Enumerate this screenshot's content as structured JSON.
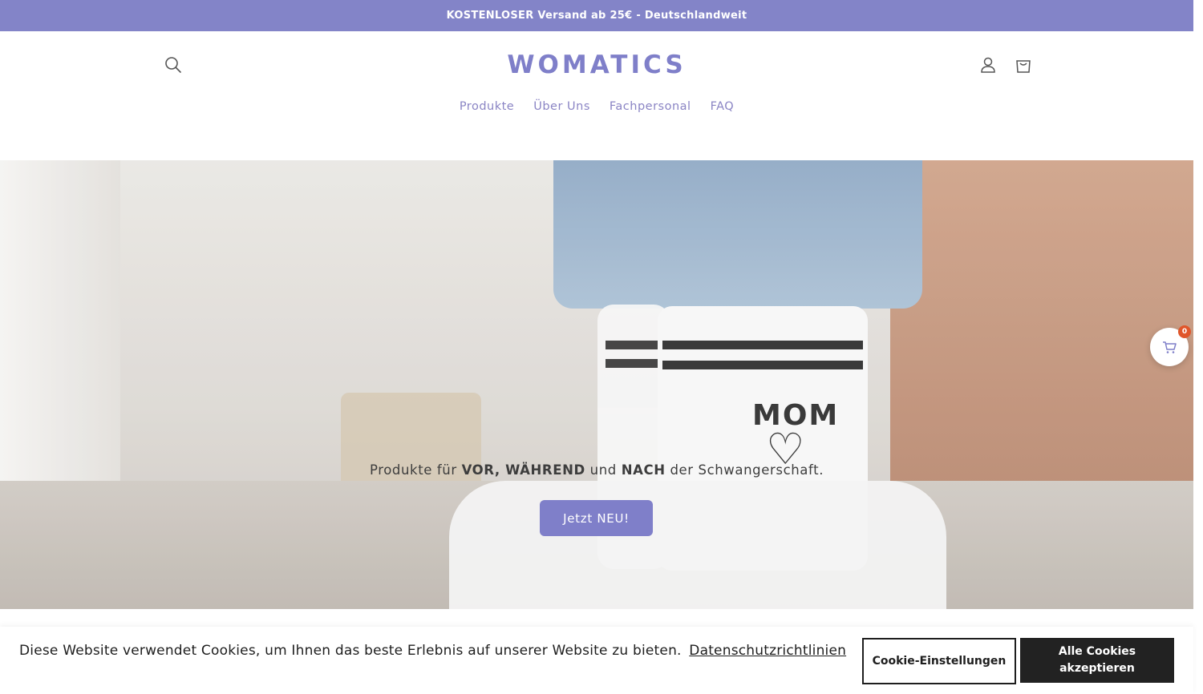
{
  "announcement": {
    "text": "KOSTENLOSER Versand ab 25€ - Deutschlandweit"
  },
  "header": {
    "logo": "WOMATICS",
    "nav": [
      "Produkte",
      "Über Uns",
      "Fachpersonal",
      "FAQ"
    ],
    "icons": [
      "search-icon",
      "account-icon",
      "cart-icon"
    ]
  },
  "hero": {
    "text_prefix": "Produkte für ",
    "text_bold_1": "VOR, WÄHREND",
    "text_middle": " und ",
    "text_bold_2": "NACH",
    "text_suffix": " der Schwangerschaft.",
    "button_label": "Jetzt NEU!",
    "sock_print": "MOM",
    "sock_heart": "♡"
  },
  "floating_cart": {
    "count": "0"
  },
  "cookie_banner": {
    "text": "Diese Website verwendet Cookies, um Ihnen das beste Erlebnis auf unserer Website zu bieten.",
    "link": "Datenschutzrichtlinien",
    "settings_button": "Cookie-Einstellungen",
    "accept_button": "Alle Cookies akzeptieren"
  },
  "colors": {
    "brand": "#7f7fc9",
    "announcement_bg": "#8384c8",
    "badge": "#e0562b",
    "dark_button": "#222222"
  }
}
